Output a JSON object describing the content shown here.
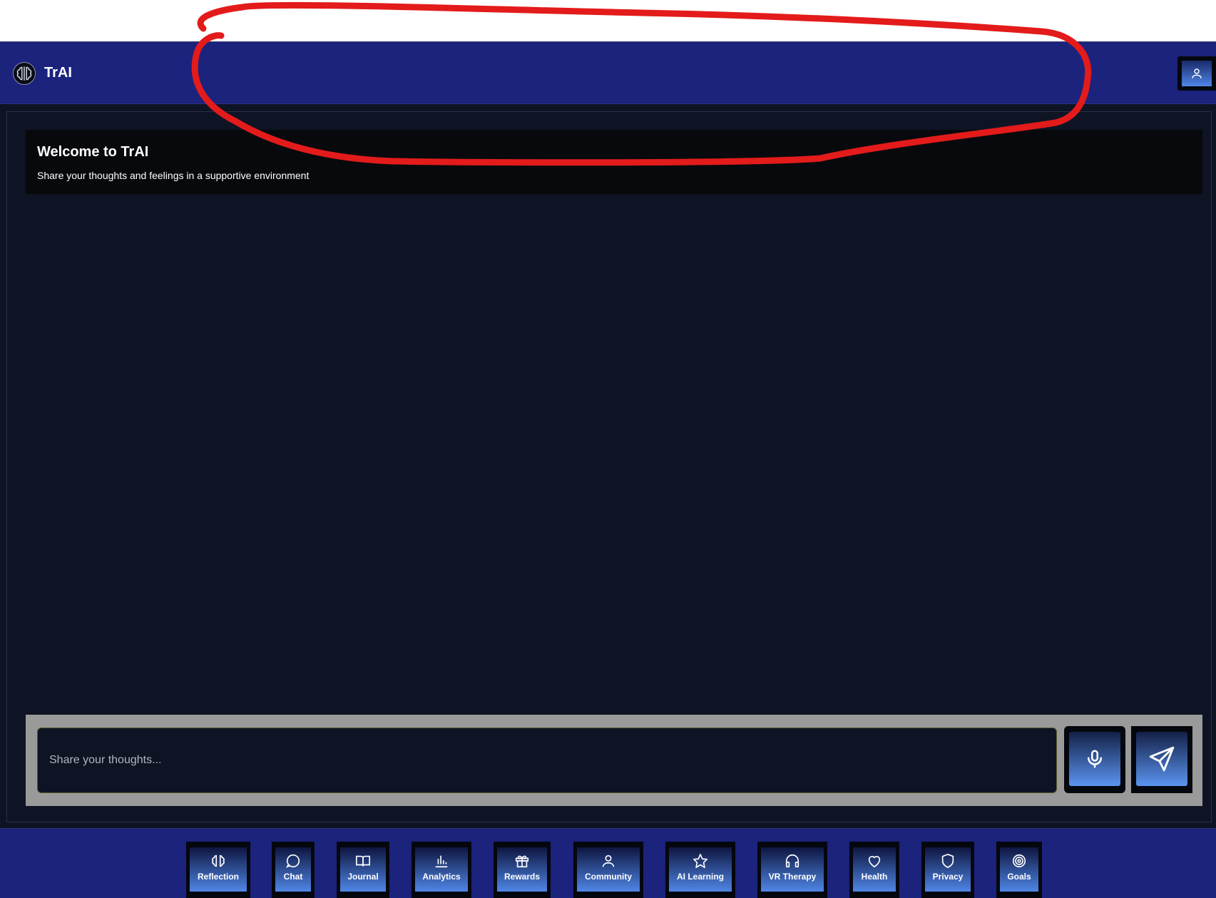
{
  "header": {
    "app_title": "TrAI",
    "logo_icon": "brain-icon",
    "profile_icon": "user-icon"
  },
  "welcome": {
    "title": "Welcome to TrAI",
    "subtitle": "Share your thoughts and feelings in a supportive environment"
  },
  "composer": {
    "placeholder": "Share your thoughts...",
    "mic_icon": "mic-icon",
    "send_icon": "send-icon"
  },
  "nav": {
    "items": [
      {
        "label": "Reflection",
        "icon": "brain-icon"
      },
      {
        "label": "Chat",
        "icon": "chat-bubble-icon"
      },
      {
        "label": "Journal",
        "icon": "open-book-icon"
      },
      {
        "label": "Analytics",
        "icon": "bar-chart-icon"
      },
      {
        "label": "Rewards",
        "icon": "gift-icon"
      },
      {
        "label": "Community",
        "icon": "user-icon"
      },
      {
        "label": "AI Learning",
        "icon": "star-icon"
      },
      {
        "label": "VR Therapy",
        "icon": "headphones-icon"
      },
      {
        "label": "Health",
        "icon": "heart-icon"
      },
      {
        "label": "Privacy",
        "icon": "shield-icon"
      },
      {
        "label": "Goals",
        "icon": "target-icon"
      }
    ]
  },
  "colors": {
    "header_bg": "#1b237d",
    "main_bg": "#0f1424",
    "button_gradient_end": "#4f86e6",
    "annotation_stroke": "#e31b1b"
  }
}
